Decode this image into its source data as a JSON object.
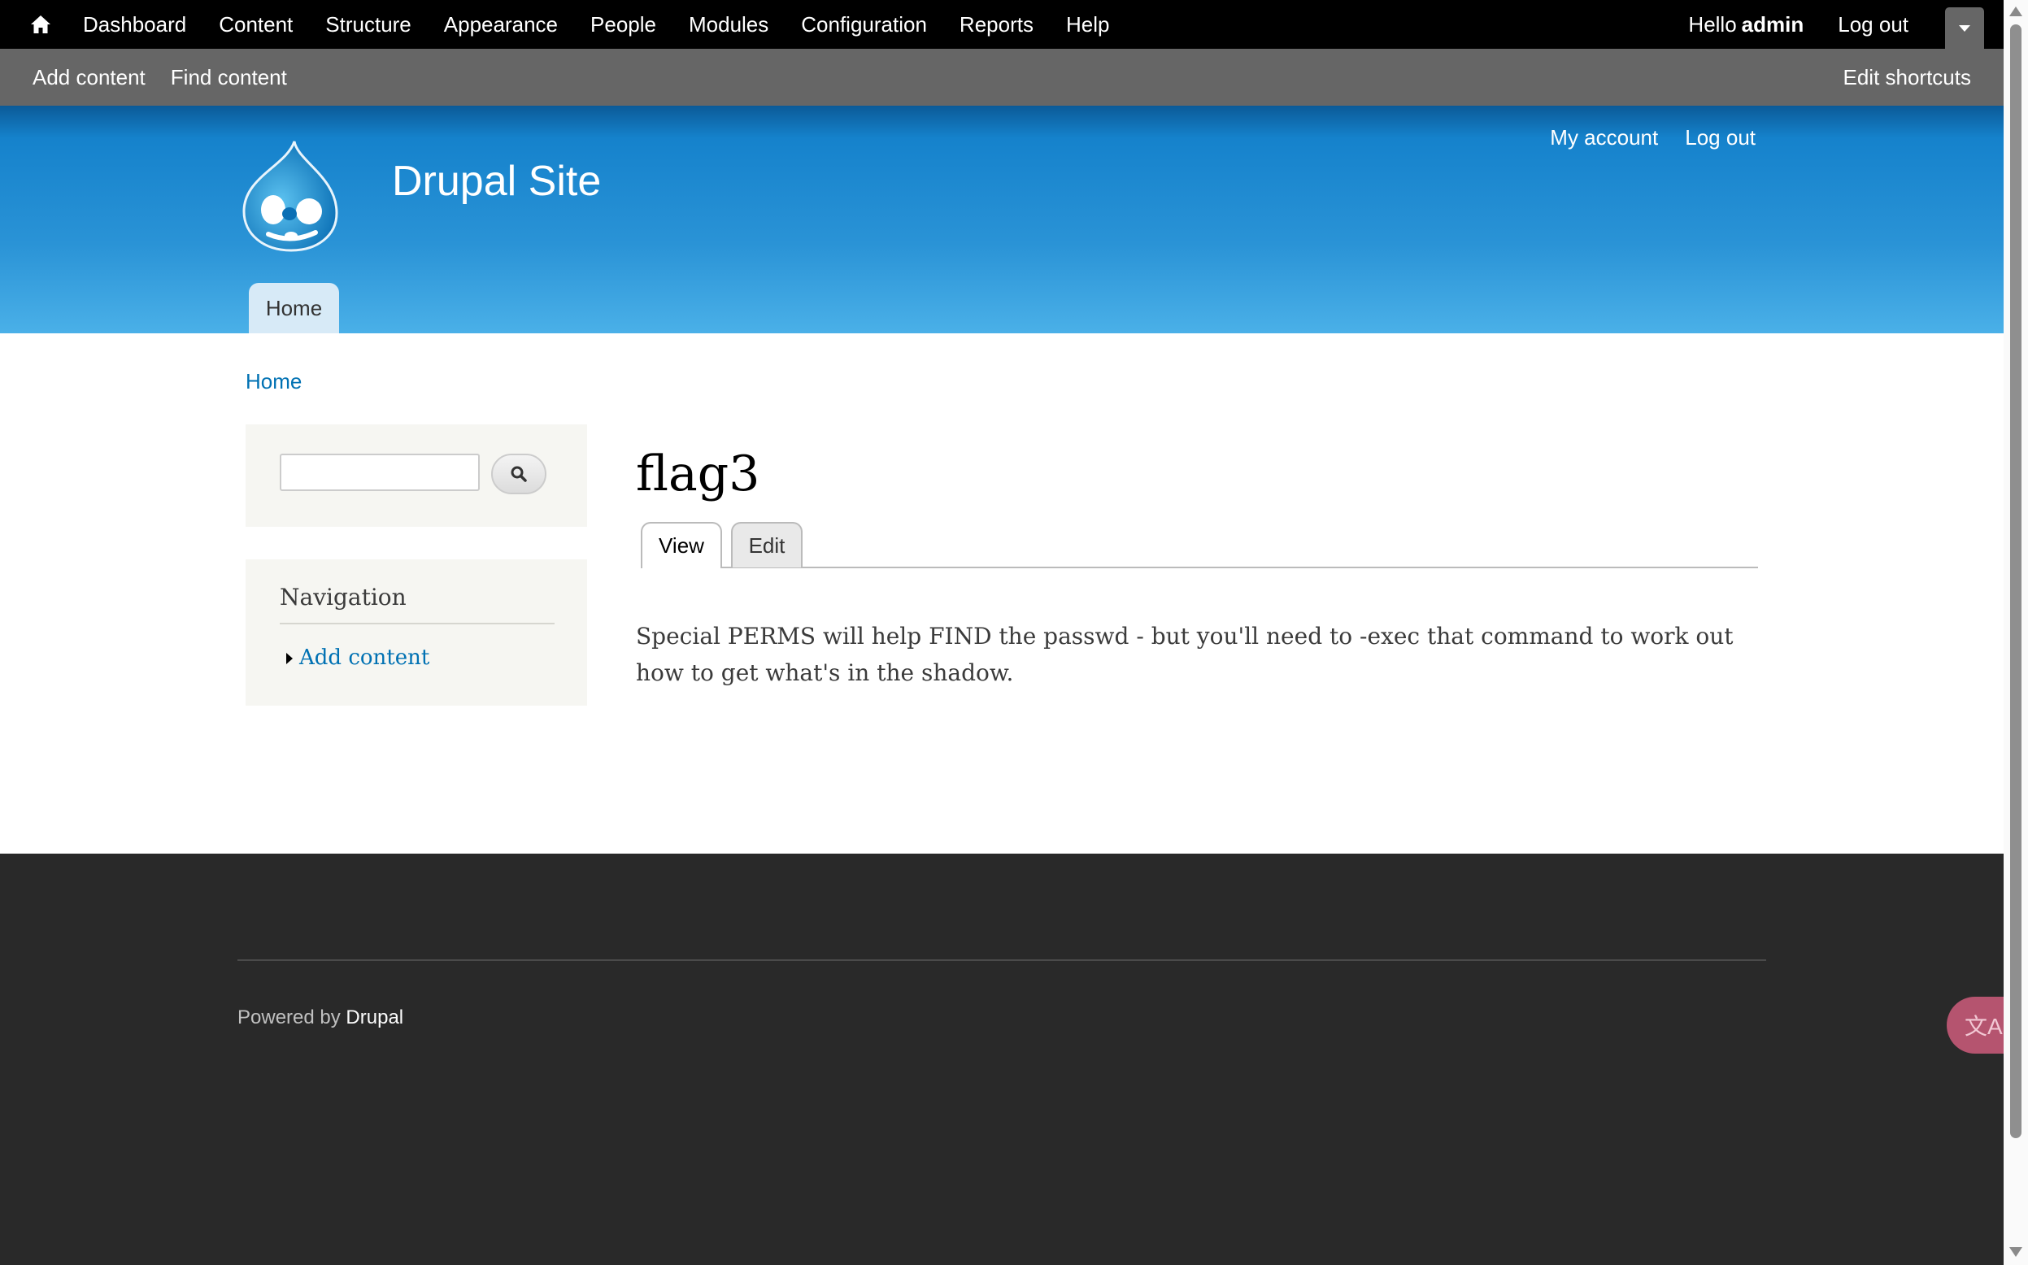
{
  "toolbar": {
    "menu": [
      "Dashboard",
      "Content",
      "Structure",
      "Appearance",
      "People",
      "Modules",
      "Configuration",
      "Reports",
      "Help"
    ],
    "hello": "Hello",
    "username": "admin",
    "logout": "Log out"
  },
  "shortcuts": {
    "items": [
      "Add content",
      "Find content"
    ],
    "edit": "Edit shortcuts"
  },
  "header": {
    "site_name": "Drupal Site",
    "secondary_menu": [
      "My account",
      "Log out"
    ],
    "main_menu": [
      "Home"
    ]
  },
  "breadcrumb": "Home",
  "sidebar": {
    "search": {
      "value": ""
    },
    "navigation": {
      "title": "Navigation",
      "items": [
        "Add content"
      ]
    }
  },
  "node": {
    "title": "flag3",
    "tabs": [
      "View",
      "Edit"
    ],
    "active_tab": "View",
    "body": "Special PERMS will help FIND the passwd - but you'll need to -exec that command to work out how to get what's in the shadow."
  },
  "footer": {
    "powered_by": "Powered by",
    "link": "Drupal"
  },
  "colors": {
    "header_blue": "#1582cc",
    "link_blue": "#0071b3",
    "footer_bg": "#292929"
  }
}
